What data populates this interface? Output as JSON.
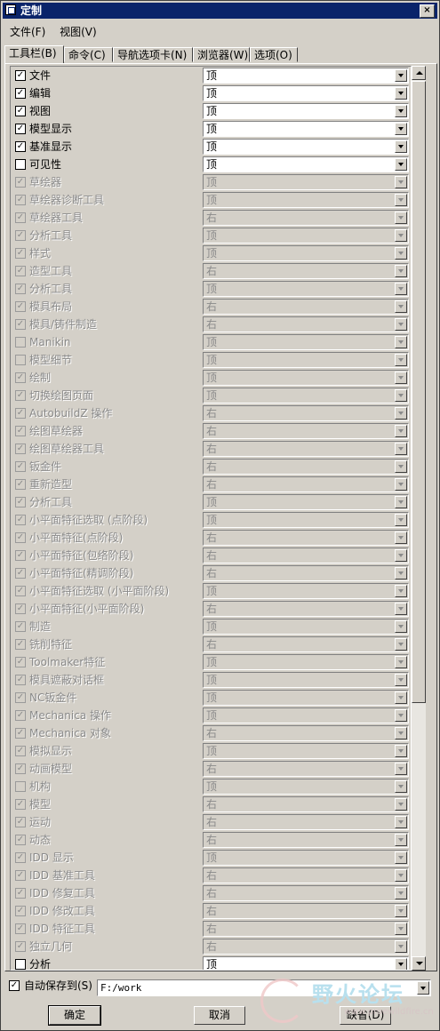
{
  "window": {
    "title": "定制",
    "close_glyph": "×"
  },
  "menu": [
    {
      "label": "文件(F)"
    },
    {
      "label": "视图(V)"
    }
  ],
  "tabs": [
    {
      "label": "工具栏(B)"
    },
    {
      "label": "命令(C)"
    },
    {
      "label": "导航选项卡(N)"
    },
    {
      "label": "浏览器(W)"
    },
    {
      "label": "选项(O)"
    }
  ],
  "rows": [
    {
      "label": "文件",
      "checked": true,
      "enabled": true,
      "value": "顶"
    },
    {
      "label": "编辑",
      "checked": true,
      "enabled": true,
      "value": "顶"
    },
    {
      "label": "视图",
      "checked": true,
      "enabled": true,
      "value": "顶"
    },
    {
      "label": "模型显示",
      "checked": true,
      "enabled": true,
      "value": "顶"
    },
    {
      "label": "基准显示",
      "checked": true,
      "enabled": true,
      "value": "顶"
    },
    {
      "label": "可见性",
      "checked": false,
      "enabled": true,
      "value": "顶"
    },
    {
      "label": "草绘器",
      "checked": true,
      "enabled": false,
      "value": "顶"
    },
    {
      "label": "草绘器诊断工具",
      "checked": true,
      "enabled": false,
      "value": "顶"
    },
    {
      "label": "草绘器工具",
      "checked": true,
      "enabled": false,
      "value": "右"
    },
    {
      "label": "分析工具",
      "checked": true,
      "enabled": false,
      "value": "顶"
    },
    {
      "label": "样式",
      "checked": true,
      "enabled": false,
      "value": "顶"
    },
    {
      "label": "造型工具",
      "checked": true,
      "enabled": false,
      "value": "右"
    },
    {
      "label": "分析工具",
      "checked": true,
      "enabled": false,
      "value": "顶"
    },
    {
      "label": "模具布局",
      "checked": true,
      "enabled": false,
      "value": "右"
    },
    {
      "label": "模具/铸件制造",
      "checked": true,
      "enabled": false,
      "value": "右"
    },
    {
      "label": "Manikin",
      "checked": false,
      "enabled": false,
      "value": "顶"
    },
    {
      "label": "模型细节",
      "checked": false,
      "enabled": false,
      "value": "顶"
    },
    {
      "label": "绘制",
      "checked": true,
      "enabled": false,
      "value": "顶"
    },
    {
      "label": "切换绘图页面",
      "checked": true,
      "enabled": false,
      "value": "顶"
    },
    {
      "label": "AutobuildZ 操作",
      "checked": true,
      "enabled": false,
      "value": "右"
    },
    {
      "label": "绘图草绘器",
      "checked": true,
      "enabled": false,
      "value": "右"
    },
    {
      "label": "绘图草绘器工具",
      "checked": true,
      "enabled": false,
      "value": "右"
    },
    {
      "label": "钣金件",
      "checked": true,
      "enabled": false,
      "value": "右"
    },
    {
      "label": "重新造型",
      "checked": true,
      "enabled": false,
      "value": "右"
    },
    {
      "label": "分析工具",
      "checked": true,
      "enabled": false,
      "value": "顶"
    },
    {
      "label": "小平面特征选取 (点阶段)",
      "checked": true,
      "enabled": false,
      "value": "顶"
    },
    {
      "label": "小平面特征(点阶段)",
      "checked": true,
      "enabled": false,
      "value": "右"
    },
    {
      "label": "小平面特征(包络阶段)",
      "checked": true,
      "enabled": false,
      "value": "右"
    },
    {
      "label": "小平面特征(精调阶段)",
      "checked": true,
      "enabled": false,
      "value": "右"
    },
    {
      "label": "小平面特征选取 (小平面阶段)",
      "checked": true,
      "enabled": false,
      "value": "顶"
    },
    {
      "label": "小平面特征(小平面阶段)",
      "checked": true,
      "enabled": false,
      "value": "右"
    },
    {
      "label": "制造",
      "checked": true,
      "enabled": false,
      "value": "顶"
    },
    {
      "label": "铣削特征",
      "checked": true,
      "enabled": false,
      "value": "右"
    },
    {
      "label": "Toolmaker特征",
      "checked": true,
      "enabled": false,
      "value": "顶"
    },
    {
      "label": "模具遮蔽对话框",
      "checked": true,
      "enabled": false,
      "value": "顶"
    },
    {
      "label": "NC钣金件",
      "checked": true,
      "enabled": false,
      "value": "顶"
    },
    {
      "label": "Mechanica 操作",
      "checked": true,
      "enabled": false,
      "value": "顶"
    },
    {
      "label": "Mechanica 对象",
      "checked": true,
      "enabled": false,
      "value": "右"
    },
    {
      "label": "模拟显示",
      "checked": true,
      "enabled": false,
      "value": "顶"
    },
    {
      "label": "动画模型",
      "checked": true,
      "enabled": false,
      "value": "右"
    },
    {
      "label": "机构",
      "checked": false,
      "enabled": false,
      "value": "顶"
    },
    {
      "label": "模型",
      "checked": true,
      "enabled": false,
      "value": "右"
    },
    {
      "label": "运动",
      "checked": true,
      "enabled": false,
      "value": "右"
    },
    {
      "label": "动态",
      "checked": true,
      "enabled": false,
      "value": "右"
    },
    {
      "label": "IDD 显示",
      "checked": true,
      "enabled": false,
      "value": "顶"
    },
    {
      "label": "IDD 基准工具",
      "checked": true,
      "enabled": false,
      "value": "右"
    },
    {
      "label": "IDD 修复工具",
      "checked": true,
      "enabled": false,
      "value": "右"
    },
    {
      "label": "IDD 修改工具",
      "checked": true,
      "enabled": false,
      "value": "右"
    },
    {
      "label": "IDD 特征工具",
      "checked": true,
      "enabled": false,
      "value": "右"
    },
    {
      "label": "独立几何",
      "checked": true,
      "enabled": false,
      "value": "右"
    },
    {
      "label": "分析",
      "checked": false,
      "enabled": true,
      "value": "顶"
    }
  ],
  "checkmark": "✓",
  "autosave": {
    "label": "自动保存到(S)",
    "checked": true,
    "path": "F:/work"
  },
  "buttons": {
    "ok": "确定",
    "cancel": "取消",
    "default": "缺省(D)"
  },
  "watermark": {
    "text": "野火论坛",
    "url": "www.proewildfire.cn"
  }
}
